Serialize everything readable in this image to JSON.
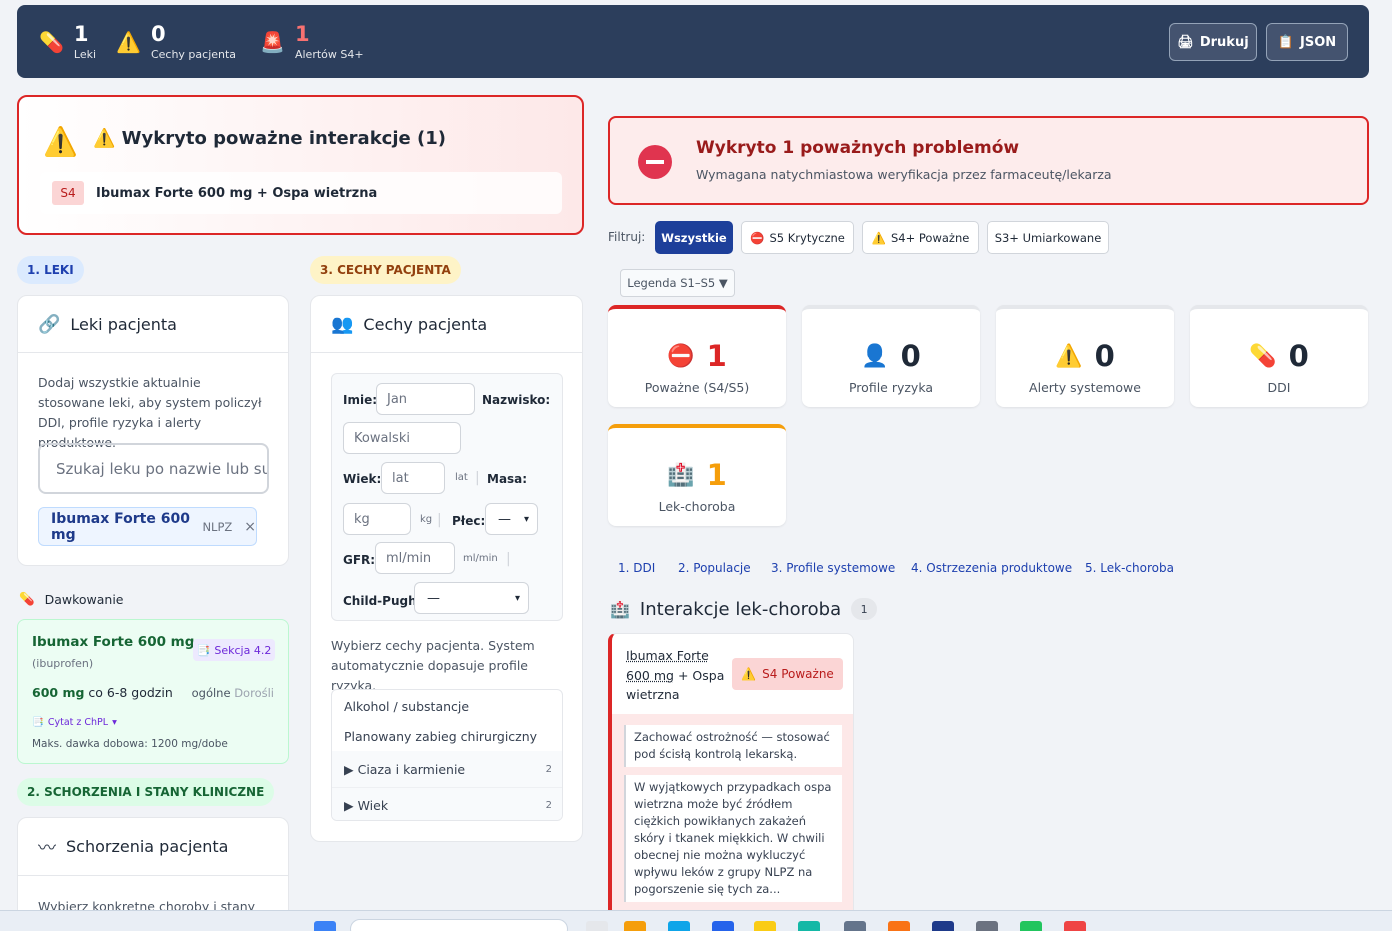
{
  "header": {
    "stats": [
      {
        "icon": "💊",
        "icon_name": "pill-icon",
        "value": "1",
        "label": "Leki"
      },
      {
        "icon": "⚠️",
        "icon_name": "warning-icon",
        "value": "0",
        "label": "Cechy pacjenta"
      },
      {
        "icon": "🚨",
        "icon_name": "siren-icon",
        "value": "1",
        "label": "Alertów S4+"
      }
    ],
    "print_label": "Drukuj",
    "json_label": "JSON"
  },
  "alert": {
    "title": "⚠️ Wykryto poważne interakcje (1)",
    "badge": "S4",
    "item": "Ibumax Forte 600 mg + Ospa wietrzna"
  },
  "tags": {
    "meds": "1. LEKI",
    "traits": "3. CECHY PACJENTA",
    "diseases": "2. SCHORZENIA I STANY KLINICZNE"
  },
  "meds_card": {
    "title": "Leki pacjenta",
    "description": "Dodaj wszystkie aktualnie stosowane leki, aby system policzył DDI, profile ryzyka i alerty produktowe.",
    "search_placeholder": "Szukaj leku po nazwie lub sub",
    "chip_name": "Ibumax Forte 600 mg",
    "chip_sub": "NLPZ",
    "chip_remove": "×"
  },
  "dosage": {
    "title": "Dawkowanie",
    "drug": "Ibumax Forte 600 mg",
    "substance": "(ibuprofen)",
    "section": "Sekcja 4.2",
    "dose": "600 mg",
    "frequency": "co 6-8 godzin",
    "scope": "ogólne",
    "population": "Dorośli",
    "citation": "Cytat z ChPL",
    "max": "Maks. dawka dobowa: 1200 mg/dobe"
  },
  "traits_card": {
    "title": "Cechy pacjenta",
    "first_name_label": "Imie:",
    "first_name_placeholder": "Jan",
    "last_name_label": "Nazwisko:",
    "last_name_placeholder": "Kowalski",
    "age_label": "Wiek:",
    "age_placeholder": "lat",
    "age_unit": "lat",
    "mass_label": "Masa:",
    "mass_placeholder": "kg",
    "mass_unit": "kg",
    "sex_label": "Płec:",
    "sex_value": "—",
    "gfr_label": "GFR:",
    "gfr_placeholder": "ml/min",
    "gfr_unit": "ml/min",
    "childpugh_label": "Child-Pugh:",
    "childpugh_value": "—",
    "description": "Wybierz cechy pacjenta. System automatycznie dopasuje profile ryzyka.",
    "options": [
      "Alkohol / substancje",
      "Planowany zabieg chirurgiczny"
    ],
    "groups": [
      {
        "label": "▶ Ciaza i karmienie",
        "count": "2"
      },
      {
        "label": "▶ Wiek",
        "count": "2"
      }
    ]
  },
  "diseases_card": {
    "title": "Schorzenia pacjenta",
    "description": "Wybierz konkretne choroby i stany"
  },
  "banner": {
    "title": "Wykryto 1 poważnych problemów",
    "subtitle": "Wymagana natychmiastowa weryfikacja przez farmaceutę/lekarza"
  },
  "filters": {
    "label": "Filtruj:",
    "buttons": [
      "Wszystkie",
      "S5 Krytyczne",
      "S4+ Poważne",
      "S3+ Umiarkowane"
    ],
    "legend": "Legenda S1–S5 ▼"
  },
  "summary": [
    {
      "icon_name": "stop-icon",
      "value": "1",
      "label": "Poważne (S4/S5)",
      "color": "#dc2626"
    },
    {
      "icon_name": "person-icon",
      "value": "0",
      "label": "Profile ryzyka",
      "color": "#e5e7eb"
    },
    {
      "icon_name": "warning-icon",
      "value": "0",
      "label": "Alerty systemowe",
      "color": "#e5e7eb"
    },
    {
      "icon_name": "pill-icon",
      "value": "0",
      "label": "DDI",
      "color": "#e5e7eb"
    },
    {
      "icon_name": "hospital-icon",
      "value": "1",
      "label": "Lek-choroba",
      "color": "#f59e0b"
    }
  ],
  "tabs": [
    "1. DDI",
    "2. Populacje",
    "3. Profile systemowe",
    "4. Ostrzezenia produktowe",
    "5. Lek-choroba"
  ],
  "interactions": {
    "title": "Interakcje lek-choroba",
    "count": "1",
    "drug": "Ibumax Forte 600 mg",
    "plus": "+",
    "disease": "Ospa wietrzna",
    "severity": "S4 Poważne",
    "note1": "Zachować ostrożność — stosować pod ścisłą kontrolą lekarską.",
    "note2": "W wyjątkowych przypadkach ospa wietrzna może być źródłem ciężkich powikłanych zakażeń skóry i tkanek miękkich. W chwili obecnej nie można wykluczyć wpływu leków z grupy NLPZ na pogorszenie się tych za..."
  }
}
